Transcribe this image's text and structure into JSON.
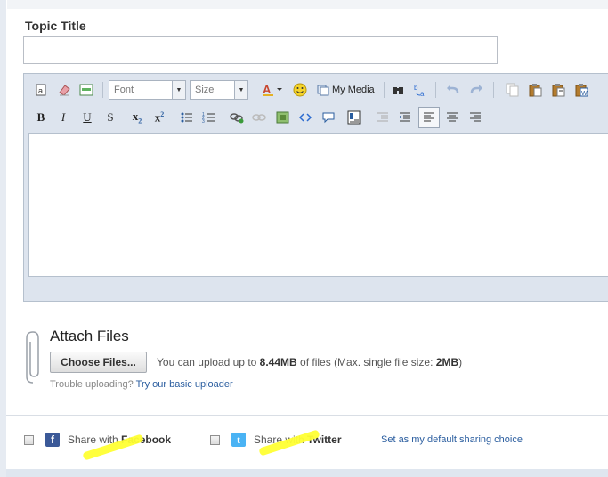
{
  "topic": {
    "label": "Topic Title",
    "value": ""
  },
  "editor": {
    "font_placeholder": "Font",
    "size_placeholder": "Size",
    "my_media_label": "My Media",
    "body_text": ""
  },
  "attach": {
    "title": "Attach Files",
    "choose_button": "Choose Files...",
    "info_prefix": "You can upload up to",
    "info_limit": "8.44MB",
    "info_middle": "of files (Max. single file size:",
    "info_single": "2MB",
    "info_suffix": ")",
    "trouble_text": "Trouble uploading?",
    "trouble_link": "Try our basic uploader"
  },
  "share": {
    "facebook_prefix": "Share with",
    "facebook_name": "Facebook",
    "twitter_prefix": "Share with",
    "twitter_name": "Twitter",
    "default_link": "Set as my default sharing choice"
  },
  "colors": {
    "facebook": "#3b5998",
    "twitter": "#4ab3f4",
    "link": "#2a5d9f",
    "highlight": "#ffff33"
  }
}
